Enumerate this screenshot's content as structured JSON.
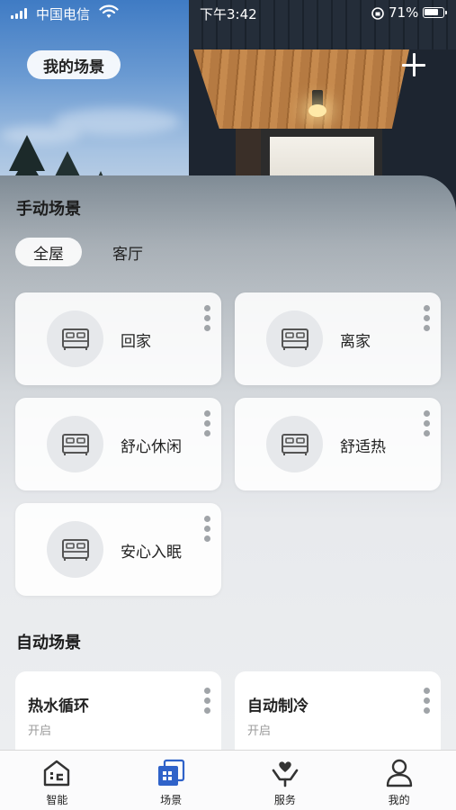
{
  "status": {
    "carrier": "中国电信",
    "time": "下午3:42",
    "battery": "71%",
    "battery_level": 0.71
  },
  "header": {
    "title": "我的场景"
  },
  "manual": {
    "title": "手动场景",
    "rooms": [
      "全屋",
      "客厅"
    ],
    "active_room": "全屋",
    "scenes": [
      {
        "label": "回家",
        "icon": "bed-icon"
      },
      {
        "label": "离家",
        "icon": "bed-icon"
      },
      {
        "label": "舒心休闲",
        "icon": "bed-icon"
      },
      {
        "label": "舒适热",
        "icon": "bed-icon"
      },
      {
        "label": "安心入眠",
        "icon": "bed-icon"
      }
    ]
  },
  "auto": {
    "title": "自动场景",
    "scenes": [
      {
        "name": "热水循环",
        "state": "开启"
      },
      {
        "name": "自动制冷",
        "state": "开启"
      }
    ]
  },
  "tabbar": {
    "tabs": [
      {
        "label": "智能",
        "icon": "smart-home-icon"
      },
      {
        "label": "场景",
        "icon": "scene-icon"
      },
      {
        "label": "服务",
        "icon": "service-icon"
      },
      {
        "label": "我的",
        "icon": "profile-icon"
      }
    ],
    "active": "场景",
    "accent": "#2f62c9"
  }
}
